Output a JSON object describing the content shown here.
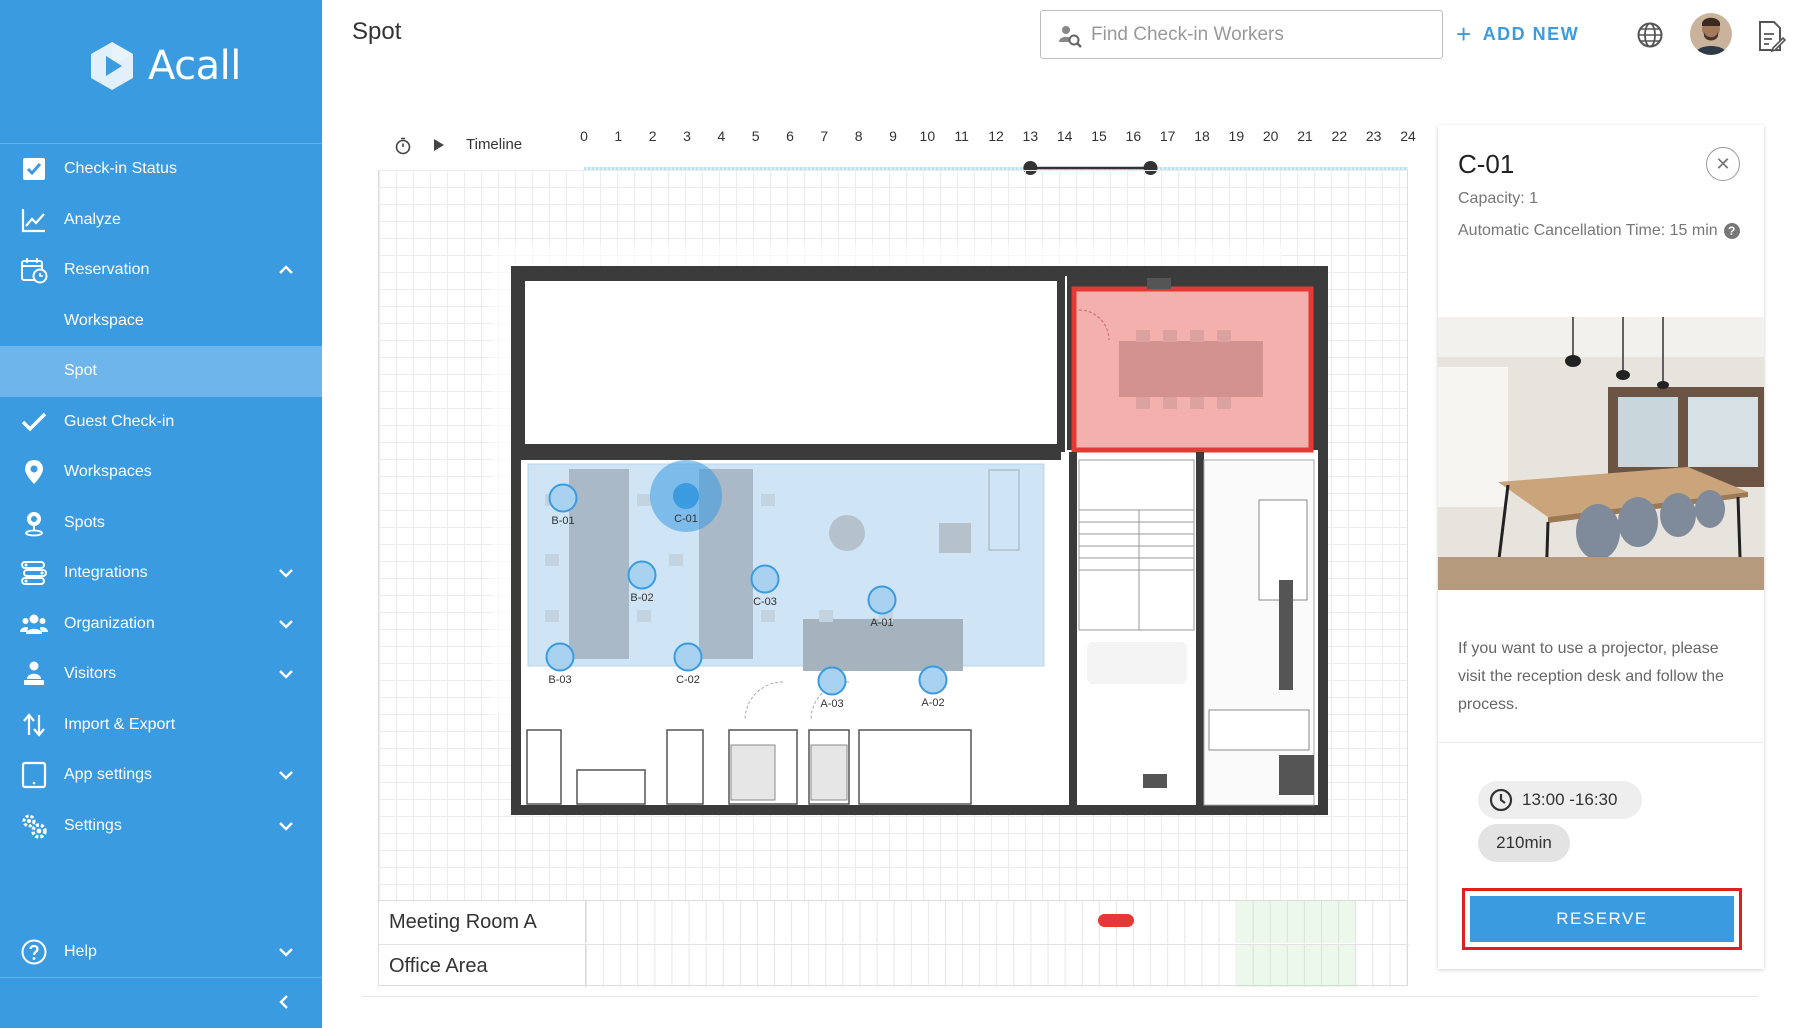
{
  "brand": {
    "name": "Acall"
  },
  "sidebar": {
    "items": [
      {
        "label": "Check-in Status",
        "icon": "checkbox-icon"
      },
      {
        "label": "Analyze",
        "icon": "chart-line-icon"
      },
      {
        "label": "Reservation",
        "icon": "calendar-clock-icon",
        "expanded": true
      },
      {
        "label": "Workspace",
        "sub": true
      },
      {
        "label": "Spot",
        "sub": true,
        "active": true
      },
      {
        "label": "Guest Check-in",
        "icon": "check-icon"
      },
      {
        "label": "Workspaces",
        "icon": "map-pin-icon"
      },
      {
        "label": "Spots",
        "icon": "location-pin-icon"
      },
      {
        "label": "Integrations",
        "icon": "integrations-icon",
        "has_children": true
      },
      {
        "label": "Organization",
        "icon": "people-icon",
        "has_children": true
      },
      {
        "label": "Visitors",
        "icon": "visitor-icon",
        "has_children": true
      },
      {
        "label": "Import & Export",
        "icon": "import-export-icon"
      },
      {
        "label": "App settings",
        "icon": "tablet-icon",
        "has_children": true
      },
      {
        "label": "Settings",
        "icon": "gears-icon",
        "has_children": true
      }
    ],
    "help_label": "Help"
  },
  "header": {
    "title": "Spot",
    "search_placeholder": "Find Check-in Workers",
    "add_new": "ADD NEW"
  },
  "timeline": {
    "label": "Timeline",
    "hours": [
      "0",
      "1",
      "2",
      "3",
      "4",
      "5",
      "6",
      "7",
      "8",
      "9",
      "10",
      "11",
      "12",
      "13",
      "14",
      "15",
      "16",
      "17",
      "18",
      "19",
      "20",
      "21",
      "22",
      "23",
      "24"
    ],
    "selection_start_hour": 13,
    "selection_end_hour": 16.5
  },
  "spots": [
    {
      "id": "B-01"
    },
    {
      "id": "C-01",
      "selected": true
    },
    {
      "id": "B-02"
    },
    {
      "id": "C-03"
    },
    {
      "id": "A-01"
    },
    {
      "id": "B-03"
    },
    {
      "id": "C-02"
    },
    {
      "id": "A-03"
    },
    {
      "id": "A-02"
    }
  ],
  "rows": [
    {
      "label": "Meeting Room A"
    },
    {
      "label": "Office Area"
    }
  ],
  "panel": {
    "title": "C-01",
    "capacity": "Capacity: 1",
    "cancellation": "Automatic Cancellation Time: 15 min",
    "note": "If you want to use a projector, please visit the reception desk and follow the process.",
    "time_range": "13:00 -16:30",
    "duration": "210min",
    "reserve_label": "RESERVE"
  },
  "colors": {
    "sidebar": "#3a9be0",
    "sidebar_active": "#6db5ea",
    "accent": "#3a9be0",
    "highlight_red": "#e0201e",
    "area_blue": "#cfe5f6"
  }
}
